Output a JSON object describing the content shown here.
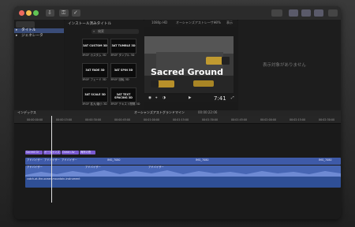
{
  "toolbar": {
    "import_icon": "download-icon",
    "keys_icon": "key-icon",
    "check_icon": "checkmark-icon"
  },
  "sidebar": {
    "items": [
      {
        "label": "タイトル",
        "icon": "title-icon",
        "selected": true
      },
      {
        "label": "ジェネレータ",
        "icon": "generator-icon",
        "selected": false
      }
    ]
  },
  "browser": {
    "header": "インストール済みタイトル",
    "search_placeholder": "検索",
    "thumbs": [
      {
        "text": "3AT CUSTOM 3D",
        "caption": "3ROF カスタム 3D"
      },
      {
        "text": "3AT TUMBLE 3D",
        "caption": "3ROF タンブル 3D"
      },
      {
        "text": "3AT FADE 3D",
        "caption": "3ROF フェード 3D"
      },
      {
        "text": "3AT SPIN 3D",
        "caption": "3ROF 回転 3D"
      },
      {
        "text": "3AT SCALE 3D",
        "caption": "3ROF 拡大/縮小 3D"
      },
      {
        "text": "3AT TEXT SPACING 3D",
        "caption": "3ROF テキスト間隔 3D"
      }
    ]
  },
  "viewer": {
    "format": "1080p HD",
    "project": "オーシャンズアストレーザー",
    "zoom": "40%",
    "view_label": "表示",
    "title_text": "Sacred Ground",
    "timecode": "7:41",
    "empty_message": "表示対象がありません"
  },
  "timeline": {
    "index_label": "インデックス",
    "project_name": "オーシャンズアストグランドマイン",
    "duration": "00:00:22:06",
    "ruler_marks": [
      "00:00:00:00",
      "00:00:15:00",
      "00:00:30:00",
      "00:00:45:00",
      "00:01:00:00",
      "00:01:15:00",
      "00:01:30:00",
      "00:01:45:00",
      "00:02:00:00",
      "00:02:15:00",
      "00:02:30:00"
    ],
    "title_clips": [
      "Sacred Gr",
      "オーシャンズ",
      "Ocean Av",
      "海岸の夜"
    ],
    "video_labels": [
      "アドバイザー",
      "アドバイザー",
      "アドバイザー",
      "IMG_7080",
      "IMG_7080",
      "IMG_7080"
    ],
    "audio_labels": [
      "アドバイザー",
      "アドバイザー",
      "アドバイザー"
    ],
    "music_label": "catch-at-the-ocean-mountain-instrument"
  },
  "colors": {
    "accent": "#5a7ad8",
    "title_clip": "#7a5ad0",
    "video_clip": "#3e5aa8",
    "audio_clip": "#4766b4"
  }
}
